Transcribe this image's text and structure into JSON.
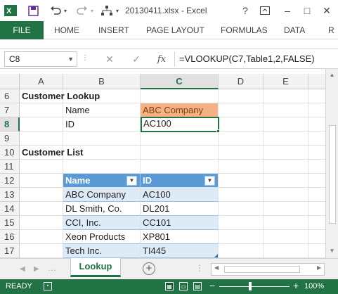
{
  "titlebar": {
    "title": "20130411.xlsx - Excel",
    "help": "?",
    "minimize": "–",
    "restore": "□",
    "close": "✕"
  },
  "ribbon": {
    "file": "FILE",
    "tabs": [
      "HOME",
      "INSERT",
      "PAGE LAYOUT",
      "FORMULAS",
      "DATA",
      "R"
    ]
  },
  "formula_bar": {
    "name_box": "C8",
    "fx": "fx",
    "formula": "=VLOOKUP(C7,Table1,2,FALSE)"
  },
  "columns": [
    "A",
    "B",
    "C",
    "D",
    "E"
  ],
  "active_column": "C",
  "rows": [
    "6",
    "7",
    "8",
    "9",
    "10",
    "11",
    "12",
    "13",
    "14",
    "15",
    "16",
    "17"
  ],
  "active_row": "8",
  "cells": {
    "r6_a": "Customer Lookup",
    "r7_b": "Name",
    "r7_c": "ABC Company",
    "r8_b": "ID",
    "r8_c": "AC100",
    "r10_a": "Customer List"
  },
  "table": {
    "headers": [
      "Name",
      "ID"
    ],
    "rows": [
      [
        "ABC Company",
        "AC100"
      ],
      [
        "DL Smith, Co.",
        "DL201"
      ],
      [
        "CCI, Inc.",
        "CC101"
      ],
      [
        "Xeon Products",
        "XP801"
      ],
      [
        "Tech Inc.",
        "TI445"
      ]
    ]
  },
  "sheets": {
    "active": "Lookup",
    "add": "+"
  },
  "status": {
    "ready": "READY",
    "zoom": "100%"
  },
  "colors": {
    "accent": "#217346",
    "table_header": "#5b9bd5",
    "table_band": "#ddebf7",
    "lookup_highlight": "#f4b183"
  }
}
